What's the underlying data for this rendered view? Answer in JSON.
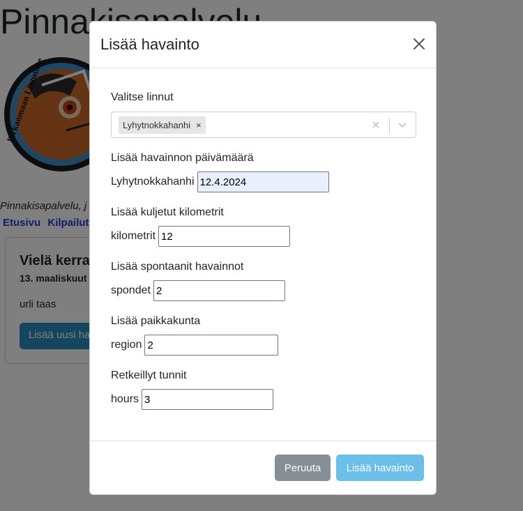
{
  "background": {
    "site_title": "Pinnakisapalvelu",
    "logo_text": "Pirkanmaan Lintutiete",
    "tagline": "Pinnakisapalvelu, j",
    "nav": [
      "Etusivu",
      "Kilpailut"
    ],
    "card": {
      "title": "Vielä kerran",
      "date": "13. maaliskuut",
      "text": "urli taas",
      "button": "Lisää uusi ha"
    }
  },
  "modal": {
    "title": "Lisää havainto",
    "birds": {
      "label": "Valitse linnut",
      "selected": "Lyhytnokkahanhi",
      "remove": "×"
    },
    "date": {
      "label": "Lisää havainnon päivämäärä",
      "prefix": "Lyhytnokkahanhi",
      "value": "12.4.2024"
    },
    "km": {
      "label": "Lisää kuljetut kilometrit",
      "prefix": "kilometrit",
      "value": "12"
    },
    "spont": {
      "label": "Lisää spontaanit havainnot",
      "prefix": "spondet",
      "value": "2"
    },
    "region": {
      "label": "Lisää paikkakunta",
      "prefix": "region",
      "value": "2"
    },
    "hours": {
      "label": "Retkeillyt tunnit",
      "prefix": "hours",
      "value": "3"
    },
    "cancel_label": "Peruuta",
    "submit_label": "Lisää havainto"
  },
  "colors": {
    "backdrop": "#808080",
    "cancel_button": "#868e96",
    "submit_button": "#6cbfe8",
    "nav_link": "#1e3ed6"
  }
}
